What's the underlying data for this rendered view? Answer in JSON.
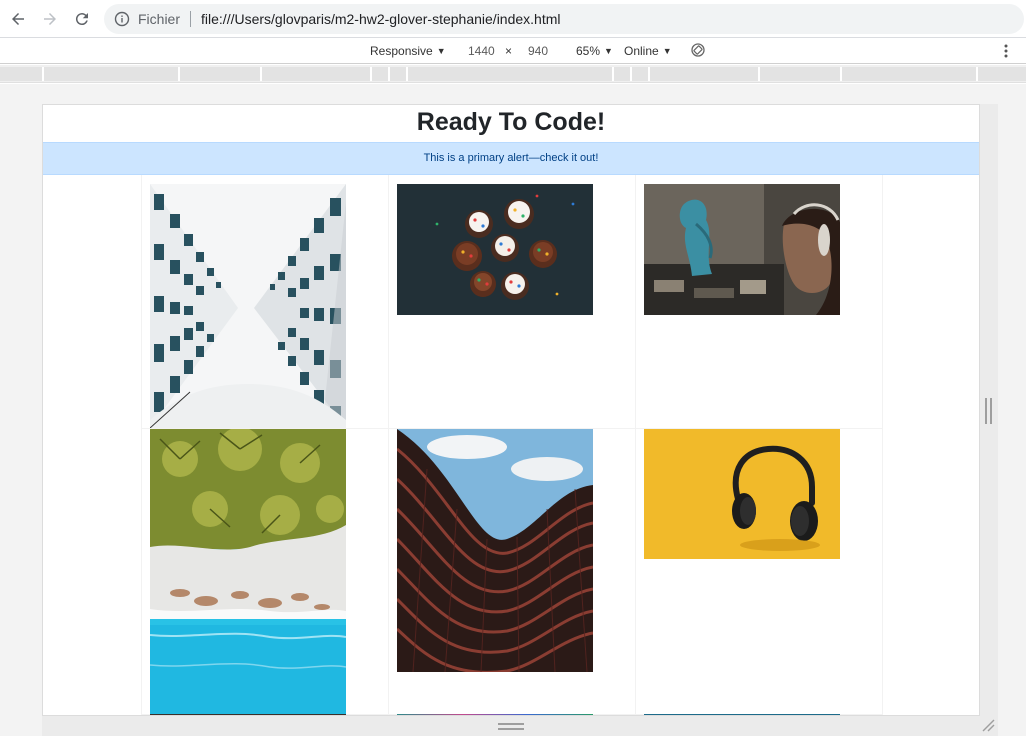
{
  "browser": {
    "scheme_label": "Fichier",
    "url": "file:///Users/glovparis/m2-hw2-glover-stephanie/index.html"
  },
  "device_toolbar": {
    "device": "Responsive",
    "width": "1440",
    "times": "×",
    "height": "940",
    "zoom": "65%",
    "throttle": "Online"
  },
  "page": {
    "title": "Ready To Code!",
    "alert": "This is a primary alert—check it out!"
  },
  "photos": [
    "building-facade-photo",
    "cupcakes-photo",
    "graffiti-headphones-photo",
    "palm-trees-beach-photo",
    "curved-building-photo",
    "headphones-yellow-photo",
    "bottom-photo-1",
    "bottom-photo-2",
    "bottom-photo-3"
  ],
  "icons": {
    "back": "back-arrow-icon",
    "forward": "forward-arrow-icon",
    "reload": "reload-icon",
    "info": "info-icon",
    "rotate": "rotate-icon",
    "menu": "kebab-menu-icon"
  },
  "colors": {
    "alert_bg": "#cce5ff",
    "alert_text": "#004085",
    "title_text": "#212529"
  }
}
